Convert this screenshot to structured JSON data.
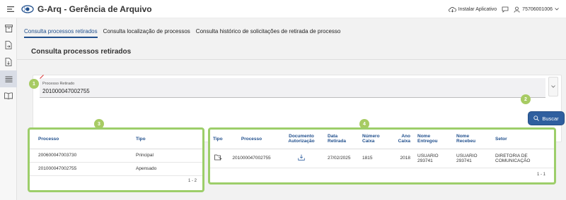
{
  "header": {
    "app_title": "G-Arq - Gerência de Arquivo",
    "install_label": "Instalar Aplicativo",
    "user_label": "75706001006"
  },
  "tabs": [
    {
      "label": "Consulta processos retirados",
      "active": true
    },
    {
      "label": "Consulta localização de processos",
      "active": false
    },
    {
      "label": "Consulta histórico de solicitações de retirada de processo",
      "active": false
    }
  ],
  "page_title": "Consulta processos retirados",
  "search": {
    "field_label": "Processo Retirado",
    "field_value": "201000047002755",
    "button_label": "Buscar"
  },
  "markers": [
    "1",
    "2",
    "3",
    "4"
  ],
  "left_table": {
    "headers": [
      "Processo",
      "Tipo"
    ],
    "rows": [
      [
        "200600047003730",
        "Principal"
      ],
      [
        "201000047002755",
        "Apensado"
      ]
    ],
    "pager": "1 - 2"
  },
  "right_table": {
    "headers": {
      "tipo": "Tipo",
      "processo": "Processo",
      "documento": [
        "Documento",
        "Autorização"
      ],
      "data": [
        "Data",
        "Retirada"
      ],
      "numero": [
        "Número",
        "Caixa"
      ],
      "ano": [
        "Ano",
        "Caixa"
      ],
      "entregou": [
        "Nome",
        "Entregou"
      ],
      "recebeu": [
        "Nome",
        "Recebeu"
      ],
      "setor": "Setor"
    },
    "row": {
      "processo": "201000047002755",
      "data": "27/02/2025",
      "numero": "1815",
      "ano": "2018",
      "entregou": [
        "USUARIO",
        "293741"
      ],
      "recebeu": [
        "USUARIO",
        "293741"
      ],
      "setor": [
        "DIRETORIA DE",
        "COMUNICAÇÃO"
      ]
    },
    "pager": "1 - 1"
  },
  "colors": {
    "accent": "#1f4e8c",
    "button": "#2f5f9f",
    "highlight": "#9dce6a",
    "marker": "#a7cb63"
  }
}
